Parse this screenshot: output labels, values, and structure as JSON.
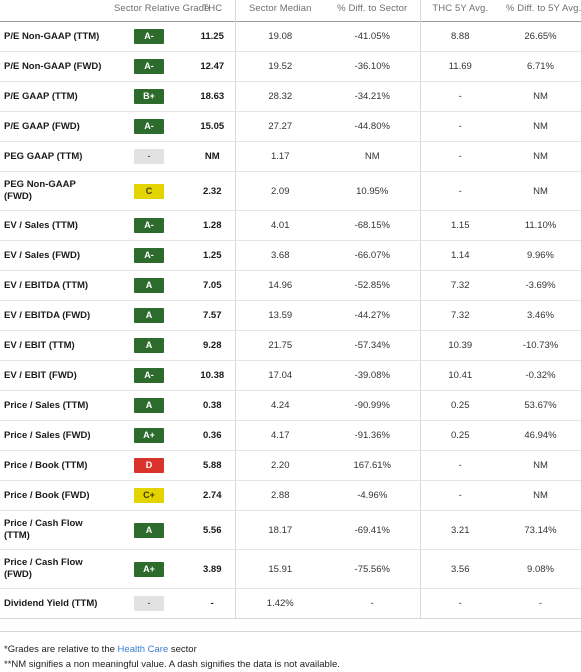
{
  "table": {
    "columns": [
      {
        "key": "metric",
        "label": ""
      },
      {
        "key": "grade",
        "label": "Sector Relative Grade"
      },
      {
        "key": "thc",
        "label": "THC"
      },
      {
        "key": "median",
        "label": "Sector Median"
      },
      {
        "key": "diff_sec",
        "label": "% Diff. to Sector"
      },
      {
        "key": "avg5y",
        "label": "THC 5Y Avg."
      },
      {
        "key": "diff_5y",
        "label": "% Diff. to 5Y Avg."
      }
    ],
    "rows": [
      {
        "metric": "P/E Non-GAAP (TTM)",
        "grade": "A-",
        "grade_color": "green",
        "thc": "11.25",
        "median": "19.08",
        "diff_sec": "-41.05%",
        "avg5y": "8.88",
        "diff_5y": "26.65%"
      },
      {
        "metric": "P/E Non-GAAP (FWD)",
        "grade": "A-",
        "grade_color": "green",
        "thc": "12.47",
        "median": "19.52",
        "diff_sec": "-36.10%",
        "avg5y": "11.69",
        "diff_5y": "6.71%"
      },
      {
        "metric": "P/E GAAP (TTM)",
        "grade": "B+",
        "grade_color": "green",
        "thc": "18.63",
        "median": "28.32",
        "diff_sec": "-34.21%",
        "avg5y": "-",
        "diff_5y": "NM"
      },
      {
        "metric": "P/E GAAP (FWD)",
        "grade": "A-",
        "grade_color": "green",
        "thc": "15.05",
        "median": "27.27",
        "diff_sec": "-44.80%",
        "avg5y": "-",
        "diff_5y": "NM"
      },
      {
        "metric": "PEG GAAP (TTM)",
        "grade": "-",
        "grade_color": "none",
        "thc": "NM",
        "median": "1.17",
        "diff_sec": "NM",
        "avg5y": "-",
        "diff_5y": "NM"
      },
      {
        "metric": "PEG Non-GAAP (FWD)",
        "grade": "C",
        "grade_color": "yellow",
        "thc": "2.32",
        "median": "2.09",
        "diff_sec": "10.95%",
        "avg5y": "-",
        "diff_5y": "NM"
      },
      {
        "metric": "EV / Sales (TTM)",
        "grade": "A-",
        "grade_color": "green",
        "thc": "1.28",
        "median": "4.01",
        "diff_sec": "-68.15%",
        "avg5y": "1.15",
        "diff_5y": "11.10%"
      },
      {
        "metric": "EV / Sales (FWD)",
        "grade": "A-",
        "grade_color": "green",
        "thc": "1.25",
        "median": "3.68",
        "diff_sec": "-66.07%",
        "avg5y": "1.14",
        "diff_5y": "9.96%"
      },
      {
        "metric": "EV / EBITDA (TTM)",
        "grade": "A",
        "grade_color": "green",
        "thc": "7.05",
        "median": "14.96",
        "diff_sec": "-52.85%",
        "avg5y": "7.32",
        "diff_5y": "-3.69%"
      },
      {
        "metric": "EV / EBITDA (FWD)",
        "grade": "A",
        "grade_color": "green",
        "thc": "7.57",
        "median": "13.59",
        "diff_sec": "-44.27%",
        "avg5y": "7.32",
        "diff_5y": "3.46%"
      },
      {
        "metric": "EV / EBIT (TTM)",
        "grade": "A",
        "grade_color": "green",
        "thc": "9.28",
        "median": "21.75",
        "diff_sec": "-57.34%",
        "avg5y": "10.39",
        "diff_5y": "-10.73%"
      },
      {
        "metric": "EV / EBIT (FWD)",
        "grade": "A-",
        "grade_color": "green",
        "thc": "10.38",
        "median": "17.04",
        "diff_sec": "-39.08%",
        "avg5y": "10.41",
        "diff_5y": "-0.32%"
      },
      {
        "metric": "Price / Sales (TTM)",
        "grade": "A",
        "grade_color": "green",
        "thc": "0.38",
        "median": "4.24",
        "diff_sec": "-90.99%",
        "avg5y": "0.25",
        "diff_5y": "53.67%"
      },
      {
        "metric": "Price / Sales (FWD)",
        "grade": "A+",
        "grade_color": "green",
        "thc": "0.36",
        "median": "4.17",
        "diff_sec": "-91.36%",
        "avg5y": "0.25",
        "diff_5y": "46.94%"
      },
      {
        "metric": "Price / Book (TTM)",
        "grade": "D",
        "grade_color": "red",
        "thc": "5.88",
        "median": "2.20",
        "diff_sec": "167.61%",
        "avg5y": "-",
        "diff_5y": "NM"
      },
      {
        "metric": "Price / Book (FWD)",
        "grade": "C+",
        "grade_color": "yellow",
        "thc": "2.74",
        "median": "2.88",
        "diff_sec": "-4.96%",
        "avg5y": "-",
        "diff_5y": "NM"
      },
      {
        "metric": "Price / Cash Flow (TTM)",
        "grade": "A",
        "grade_color": "green",
        "thc": "5.56",
        "median": "18.17",
        "diff_sec": "-69.41%",
        "avg5y": "3.21",
        "diff_5y": "73.14%"
      },
      {
        "metric": "Price / Cash Flow (FWD)",
        "grade": "A+",
        "grade_color": "green",
        "thc": "3.89",
        "median": "15.91",
        "diff_sec": "-75.56%",
        "avg5y": "3.56",
        "diff_5y": "9.08%"
      },
      {
        "metric": "Dividend Yield (TTM)",
        "grade": "-",
        "grade_color": "none",
        "thc": "-",
        "median": "1.42%",
        "diff_sec": "-",
        "avg5y": "-",
        "diff_5y": "-"
      }
    ]
  },
  "footnotes": {
    "line1_prefix": "*Grades are relative to the ",
    "line1_link": "Health Care",
    "line1_suffix": " sector",
    "line2": "**NM signifies a non meaningful value. A dash signifies the data is not available."
  },
  "colors": {
    "grade_green": "#2d6b2d",
    "grade_yellow": "#e3d400",
    "grade_red": "#d9342b",
    "grade_none": "#e2e2e2",
    "link": "#3a7ad4"
  }
}
